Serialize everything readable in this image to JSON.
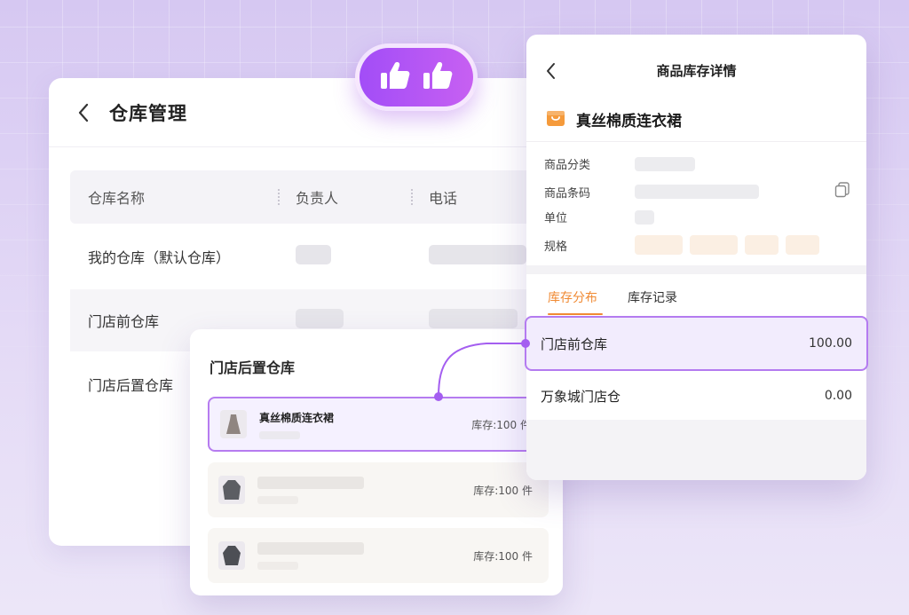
{
  "warehouse_panel": {
    "title": "仓库管理",
    "columns": [
      "仓库名称",
      "负责人",
      "电话"
    ],
    "rows": [
      {
        "name": "我的仓库（默认仓库）"
      },
      {
        "name": "门店前仓库"
      },
      {
        "name": "门店后置仓库"
      }
    ]
  },
  "store_card": {
    "title": "门店后置仓库",
    "items": [
      {
        "name": "真丝棉质连衣裙",
        "stock": "库存:100 件",
        "icon": "dress-thumbnail"
      },
      {
        "stock": "库存:100 件",
        "icon": "jacket-thumbnail"
      },
      {
        "stock": "库存:100 件",
        "icon": "coat-thumbnail"
      }
    ]
  },
  "detail_panel": {
    "title": "商品库存详情",
    "product_name": "真丝棉质连衣裙",
    "product_icon": "shopping-bag-icon",
    "attributes": {
      "category_label": "商品分类",
      "barcode_label": "商品条码",
      "unit_label": "单位",
      "spec_label": "规格"
    },
    "tabs": [
      "库存分布",
      "库存记录"
    ],
    "distribution": [
      {
        "warehouse": "门店前仓库",
        "qty": "100.00"
      },
      {
        "warehouse": "万象城门店仓",
        "qty": "0.00"
      }
    ]
  },
  "badge": {
    "icon": "thumbs-up-icon"
  },
  "colors": {
    "accent_purple": "#b47bf0",
    "accent_orange": "#f08a33",
    "badge_gradient_start": "#a24df7",
    "badge_gradient_end": "#c760f2"
  }
}
